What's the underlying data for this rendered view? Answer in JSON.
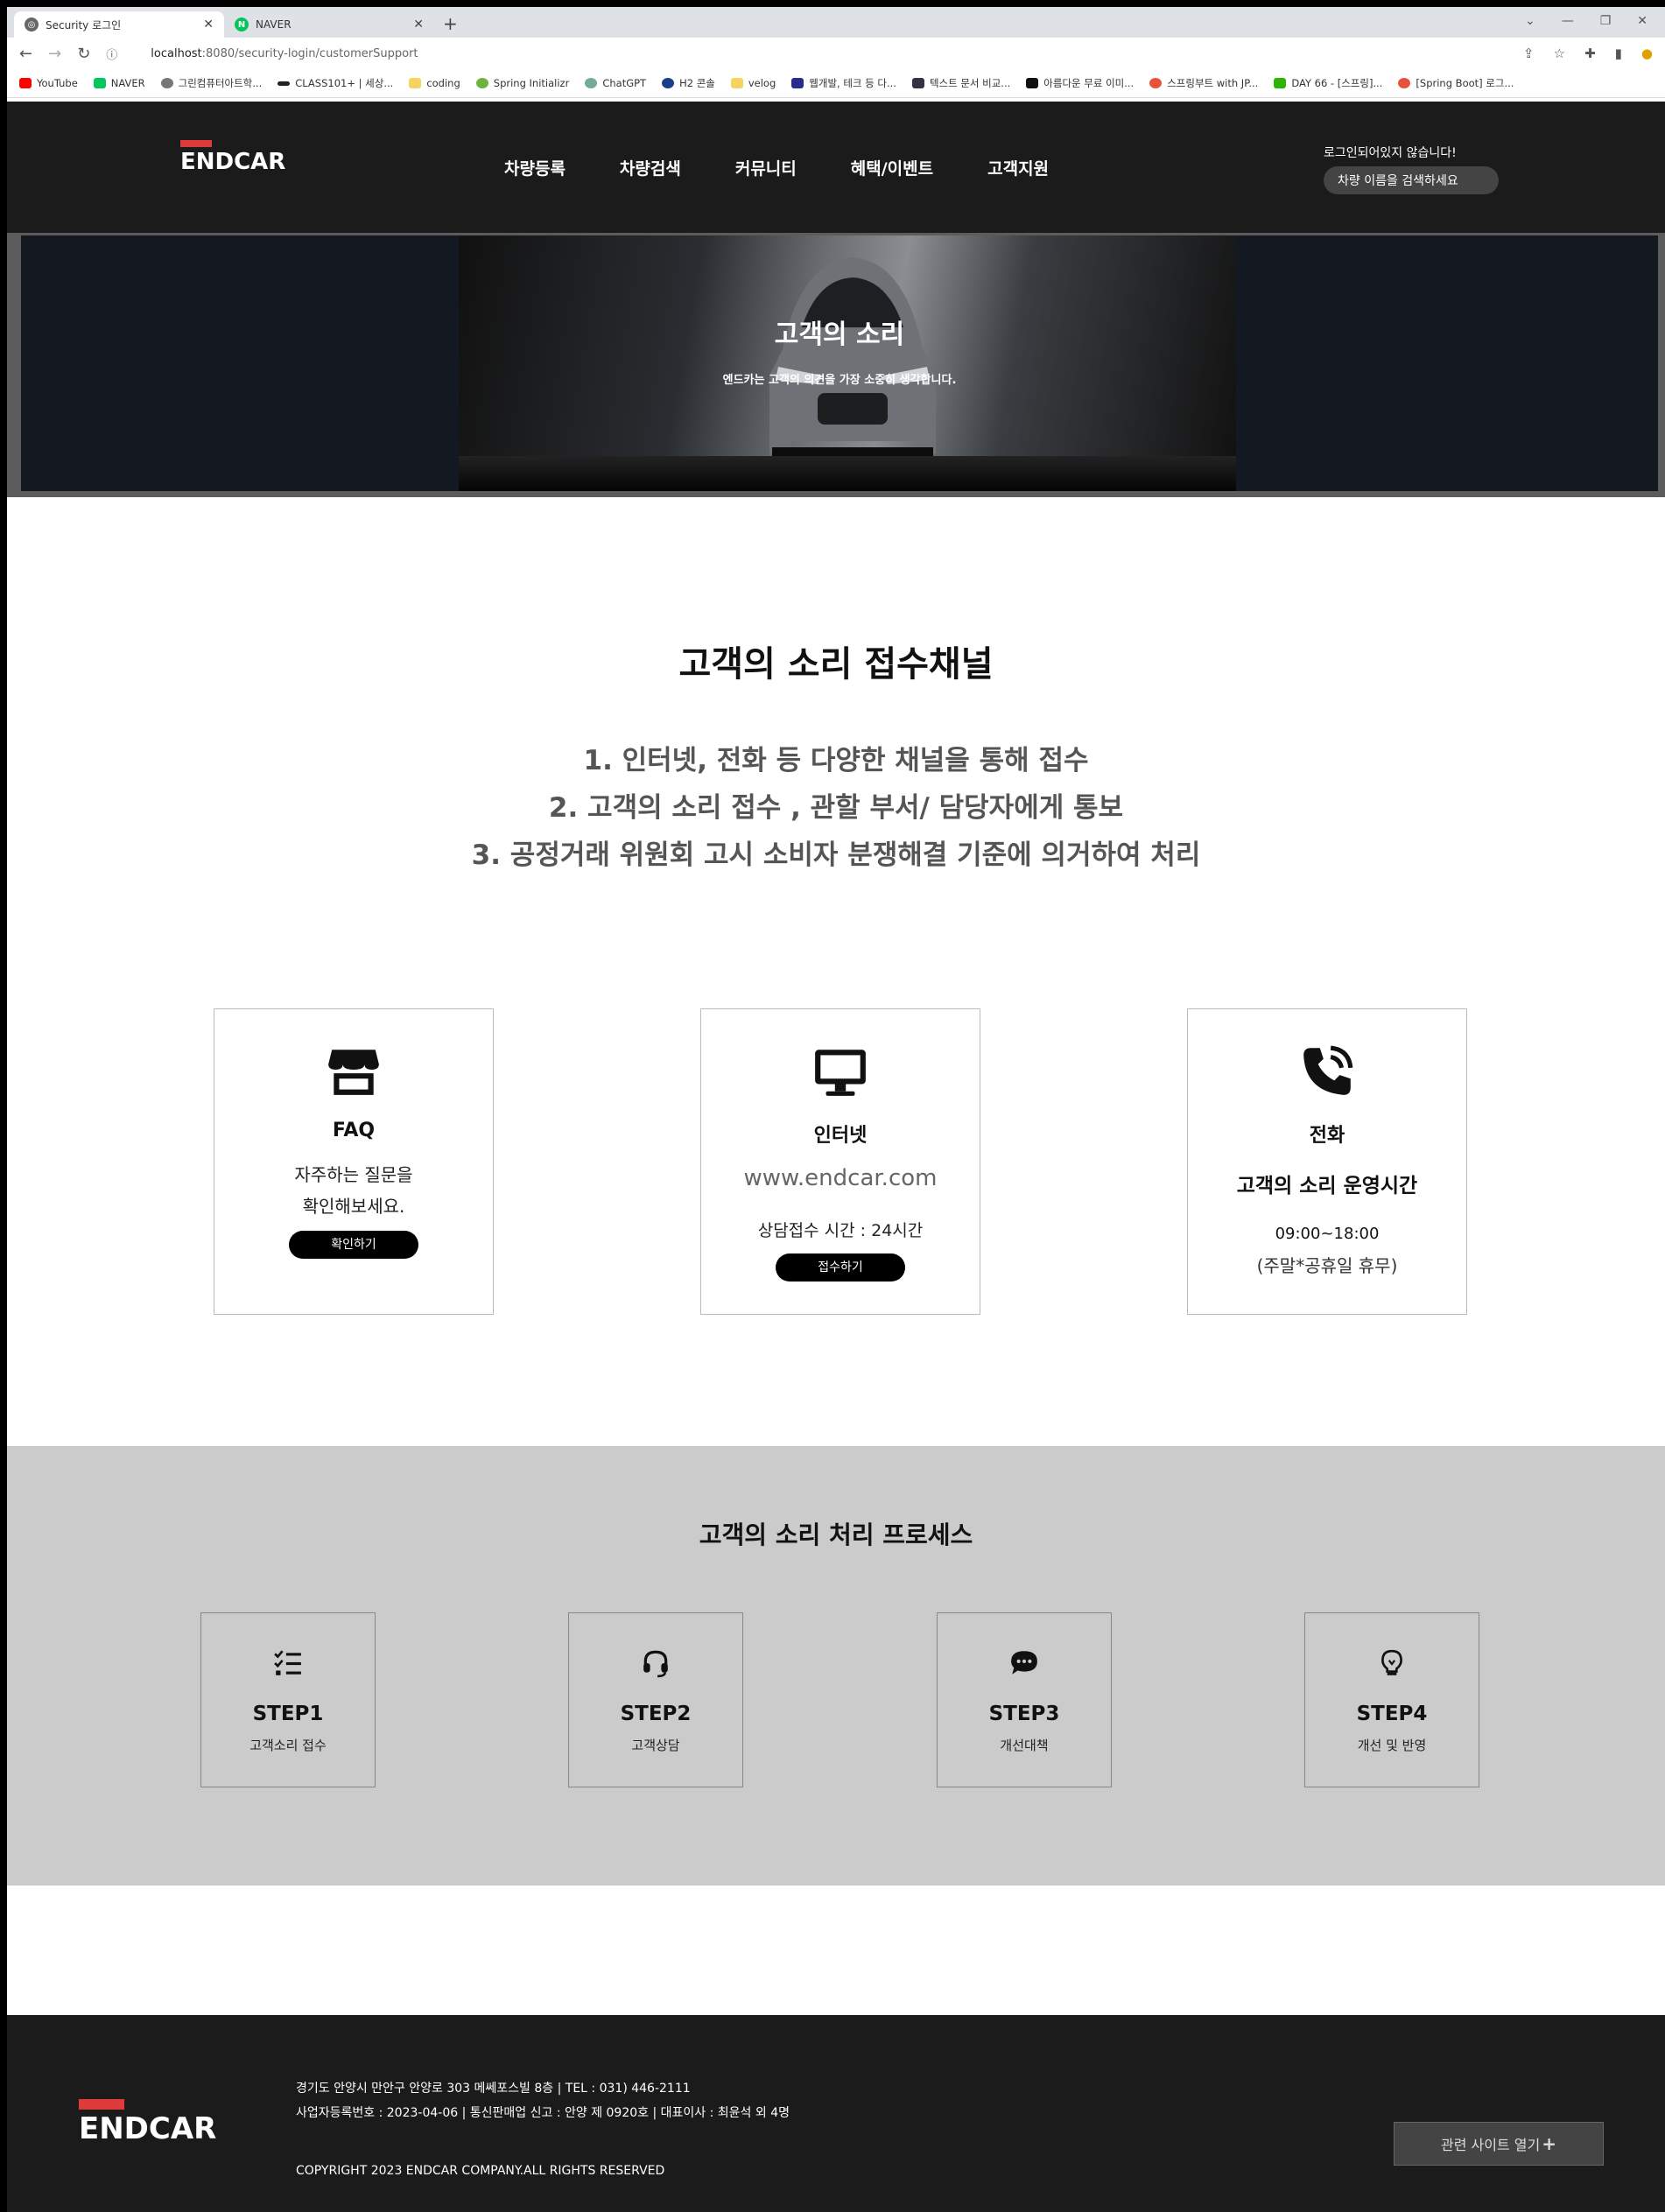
{
  "browser": {
    "tabs": [
      {
        "title": "Security 로그인",
        "active": true
      },
      {
        "title": "NAVER",
        "active": false
      }
    ],
    "url_host": "localhost",
    "url_path": ":8080/security-login/customerSupport",
    "bookmarks": [
      "YouTube",
      "NAVER",
      "그린컴퓨터아트학...",
      "CLASS101+ | 세상...",
      "coding",
      "Spring Initializr",
      "ChatGPT",
      "H2 콘솔",
      "velog",
      "웹개발, 테크 등 다...",
      "텍스트 문서 비교...",
      "아름다운 무료 이미...",
      "스프링부트 with JP...",
      "DAY 66 - [스프링]...",
      "[Spring Boot] 로그..."
    ]
  },
  "header": {
    "logo": "ENDCAR",
    "nav": [
      "차량등록",
      "차량검색",
      "커뮤니티",
      "혜택/이벤트",
      "고객지원"
    ],
    "login_status": "로그인되어있지 않습니다!",
    "search_placeholder": "차량 이름을 검색하세요"
  },
  "hero": {
    "title": "고객의 소리",
    "subtitle": "엔드카는 고객의 의견을 가장 소중히 생각합니다."
  },
  "channels": {
    "title": "고객의 소리 접수채널",
    "lines": [
      "1. 인터넷, 전화 등 다양한 채널을 통해 접수",
      "2. 고객의 소리 접수 , 관할 부서/ 담당자에게 통보",
      "3. 공정거래 위원회 고시 소비자 분쟁해결 기준에 의거하여 처리"
    ]
  },
  "cards": {
    "faq": {
      "title": "FAQ",
      "desc1": "자주하는 질문을",
      "desc2": "확인해보세요.",
      "button": "확인하기"
    },
    "internet": {
      "title": "인터넷",
      "site": "www.endcar.com",
      "hours": "상담접수 시간 : 24시간",
      "button": "접수하기"
    },
    "phone": {
      "title": "전화",
      "subtitle": "고객의 소리 운영시간",
      "hours": "09:00~18:00",
      "note": "(주말*공휴일 휴무)"
    }
  },
  "process": {
    "title": "고객의 소리 처리 프로세스",
    "steps": [
      {
        "title": "STEP1",
        "desc": "고객소리 접수",
        "icon": "checklist-icon"
      },
      {
        "title": "STEP2",
        "desc": "고객상담",
        "icon": "headset-icon"
      },
      {
        "title": "STEP3",
        "desc": "개선대책",
        "icon": "chat-bubble-icon"
      },
      {
        "title": "STEP4",
        "desc": "개선 및 반영",
        "icon": "lightbulb-icon"
      }
    ]
  },
  "footer": {
    "logo": "ENDCAR",
    "address": "경기도 안양시 만안구 안양로 303 메쎄포스빌 8층 | TEL : 031) 446-2111",
    "business": "사업자등록번호 : 2023-04-06 | 통신판매업 신고 : 안양 제 0920호 | 대표이사 : 최윤석 외 4명",
    "copyright": "COPYRIGHT 2023 ENDCAR COMPANY.ALL RIGHTS RESERVED",
    "related_button": "관련 사이트 열기"
  },
  "colors": {
    "header_bg": "#1b1b1b",
    "accent": "#e03b3b",
    "process_bg": "#cbcbcb"
  }
}
